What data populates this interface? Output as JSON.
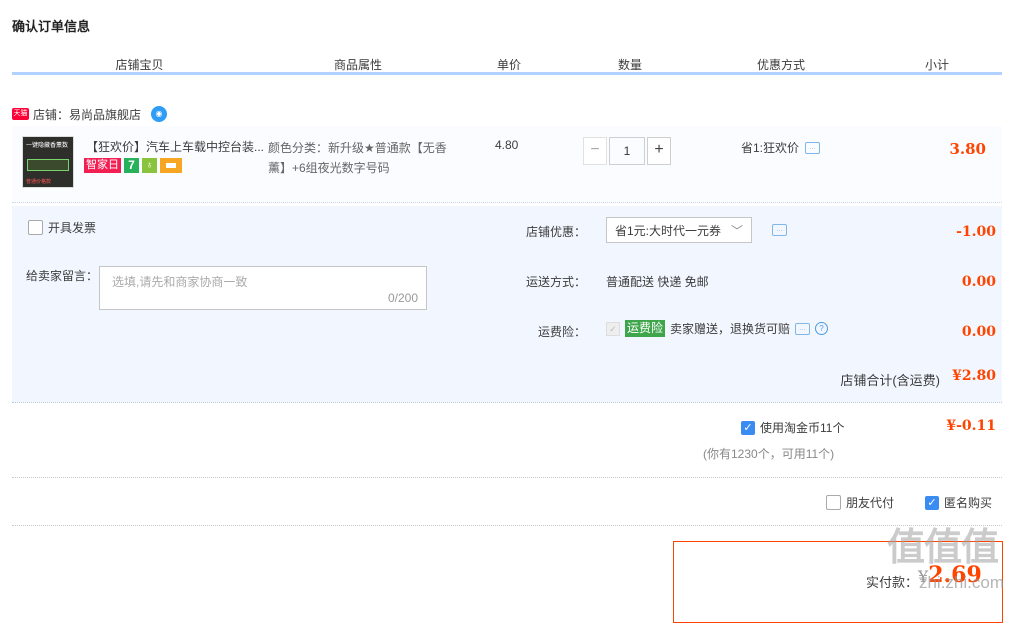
{
  "page_title": "确认订单信息",
  "columns": [
    "店铺宝贝",
    "商品属性",
    "单价",
    "数量",
    "优惠方式",
    "小计"
  ],
  "shop": {
    "badge": "天猫",
    "label": "店铺：易尚品旗舰店",
    "ww_icon": "wangwang-icon"
  },
  "item": {
    "thumb_text": "一键隐藏香薰数",
    "thumb_tag": "普通价格款",
    "title": "【狂欢价】汽车上车载中控台装...",
    "badges": {
      "smart": "智家日",
      "seven": "7",
      "g": "♁"
    },
    "attr": "颜色分类：新升级★普通款【无香薰】+6组夜光数字号码",
    "price": "4.80",
    "qty": "1",
    "minus": "−",
    "plus": "+",
    "promo": "省1:狂欢价",
    "subtotal": "3.80"
  },
  "invoice_label": "开具发票",
  "message": {
    "label": "给卖家留言：",
    "placeholder": "选填,请先和商家协商一致",
    "count": "0/200"
  },
  "discount": {
    "label": "店铺优惠：",
    "value": "省1元:大时代一元券",
    "amount": "-1.00"
  },
  "shipping": {
    "label": "运送方式：",
    "value": "普通配送 快递 免邮",
    "amount": "0.00"
  },
  "insurance": {
    "label": "运费险：",
    "tag": "运费险",
    "text": "卖家赠送，退换货可赔",
    "amount": "0.00"
  },
  "shop_total": {
    "label": "店铺合计(含运费)",
    "value": "¥2.80"
  },
  "coin": {
    "label": "使用淘金币11个",
    "sub": "(你有1230个，可用11个)",
    "amount": "¥-0.11"
  },
  "options": {
    "friend_pay": "朋友代付",
    "anonymous": "匿名购买"
  },
  "pay": {
    "label": "实付款：",
    "currency": "¥",
    "value": "2.69"
  },
  "watermark": {
    "text": "值值值",
    "domain": "zhi.zhi.com"
  },
  "colors": {
    "accent": "#ff4400",
    "header_line": "#b2d1ff",
    "panel_bg": "#f2f7ff",
    "check": "#3b8cf2"
  }
}
